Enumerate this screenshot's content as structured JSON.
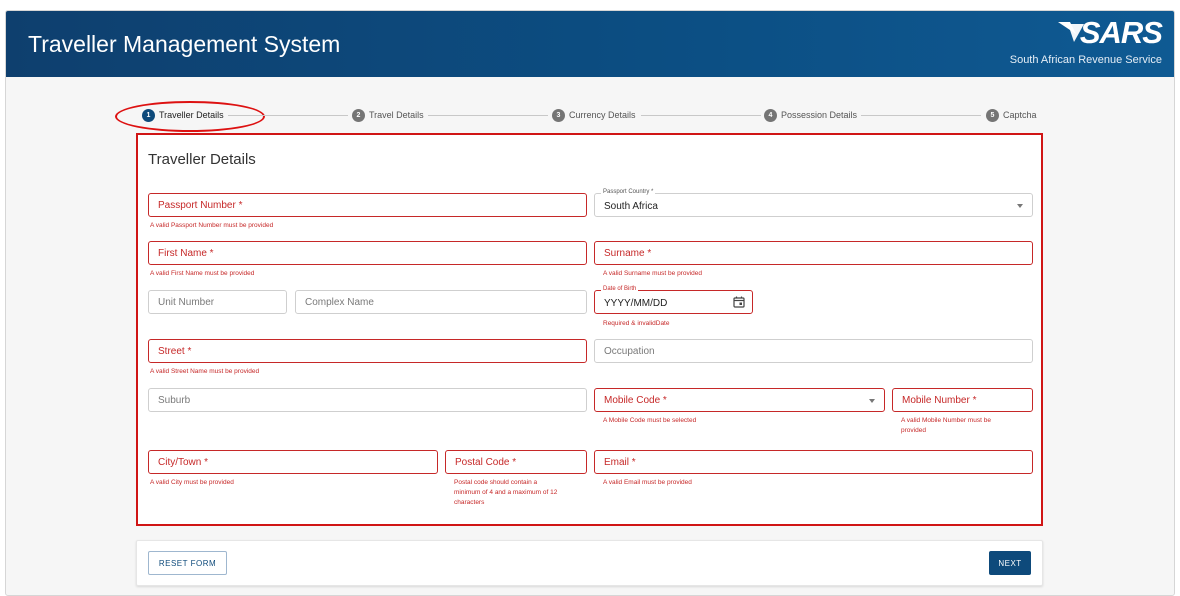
{
  "header": {
    "app_title": "Traveller Management System",
    "logo_text": "SARS",
    "logo_subtitle": "South African Revenue Service"
  },
  "stepper": {
    "steps": [
      {
        "num": "1",
        "label": "Traveller Details",
        "active": true
      },
      {
        "num": "2",
        "label": "Travel Details",
        "active": false
      },
      {
        "num": "3",
        "label": "Currency Details",
        "active": false
      },
      {
        "num": "4",
        "label": "Possession Details",
        "active": false
      },
      {
        "num": "5",
        "label": "Captcha",
        "active": false
      }
    ]
  },
  "form": {
    "title": "Traveller Details",
    "passport_number": {
      "placeholder": "Passport Number *",
      "error": "A valid Passport Number must be provided"
    },
    "passport_country": {
      "label": "Passport Country *",
      "value": "South Africa"
    },
    "first_name": {
      "placeholder": "First Name *",
      "error": "A valid First Name must be provided"
    },
    "surname": {
      "placeholder": "Surname *",
      "error": "A valid Surname must be provided"
    },
    "unit_number": {
      "placeholder": "Unit Number"
    },
    "complex_name": {
      "placeholder": "Complex Name"
    },
    "date_of_birth": {
      "label": "Date of Birth",
      "value": "YYYY/MM/DD",
      "error": "Required & invalidDate"
    },
    "street": {
      "placeholder": "Street *",
      "error": "A valid Street Name must be provided"
    },
    "occupation": {
      "placeholder": "Occupation"
    },
    "suburb": {
      "placeholder": "Suburb"
    },
    "mobile_code": {
      "placeholder": "Mobile Code *",
      "error": "A Mobile Code must be selected"
    },
    "mobile_number": {
      "placeholder": "Mobile Number *",
      "error_line1": "A valid Mobile Number must be",
      "error_line2": "provided"
    },
    "city": {
      "placeholder": "City/Town *",
      "error": "A valid City must be provided"
    },
    "postal_code": {
      "placeholder": "Postal Code *",
      "error_line1": "Postal code should contain a",
      "error_line2": "minimum of 4 and a maximum of 12",
      "error_line3": "characters"
    },
    "email": {
      "placeholder": "Email *",
      "error": "A valid Email must be provided"
    }
  },
  "actions": {
    "reset_label": "RESET FORM",
    "next_label": "NEXT"
  },
  "colors": {
    "brand_blue": "#0e4a7b",
    "error_red": "#c62828",
    "annotation_red": "#d01515"
  }
}
